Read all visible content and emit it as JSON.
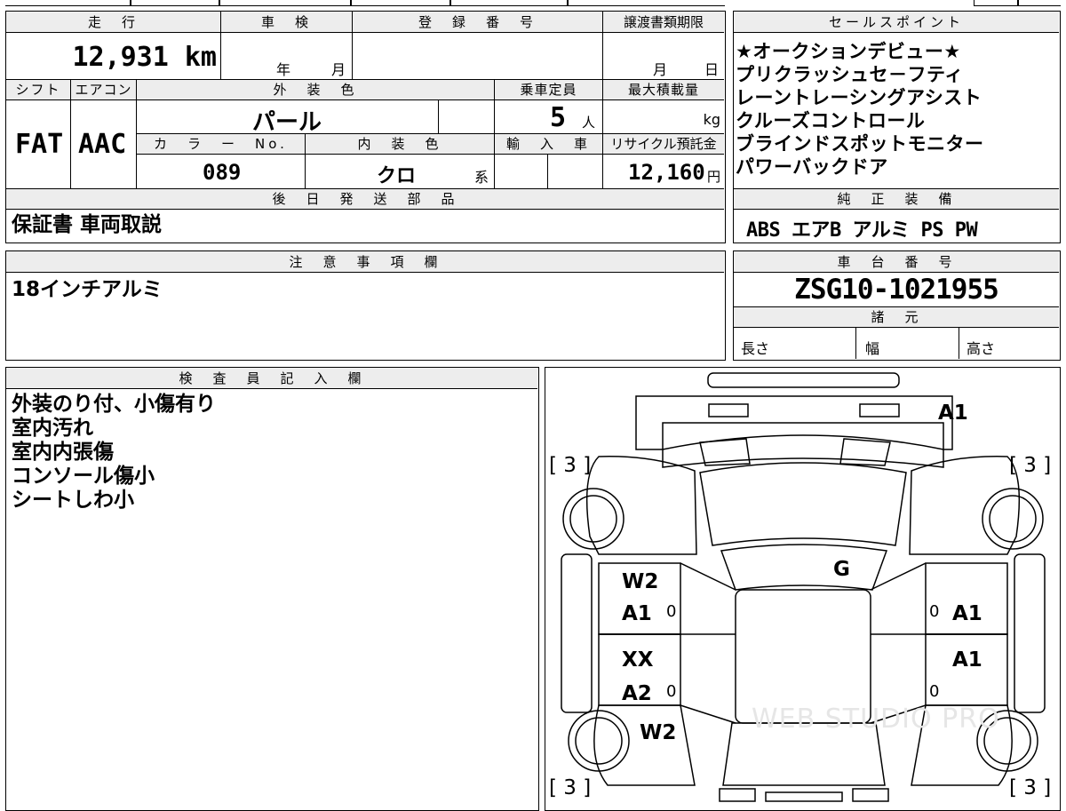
{
  "top_section": {
    "header_mileage": "走　行",
    "header_shaken": "車　検",
    "header_reg_number": "登　録　番　号",
    "header_transfer_deadline": "譲渡書類期限",
    "mileage_value": "12,931 km",
    "shaken_year_label": "年",
    "shaken_month_label": "月",
    "deadline_month_label": "月",
    "deadline_day_label": "日",
    "header_shift": "シフト",
    "header_aircon": "エアコン",
    "header_exterior_color": "外　装　色",
    "header_capacity": "乗車定員",
    "header_max_load": "最大積載量",
    "shift_value": "FAT",
    "aircon_value": "AAC",
    "exterior_color_value": "パール",
    "capacity_value": "5",
    "capacity_unit": "人",
    "max_load_unit": "kg",
    "header_color_no": "カ　ラ　ー　No.",
    "header_interior_color": "内　装　色",
    "header_import": "輸　入　車",
    "header_recycle": "リサイクル預託金",
    "color_no_value": "089",
    "interior_color_value": "クロ",
    "interior_color_suffix": "系",
    "recycle_value": "12,160",
    "recycle_unit": "円",
    "header_later_parts": "後　日　発　送　部　品",
    "later_parts_value": "保証書 車両取説"
  },
  "sales_points": {
    "header": "セールスポイント",
    "items": [
      "★オークションデビュー★",
      "プリクラッシュセ－フティ",
      "レーントレーシングアシスト",
      "クルーズコントロール",
      "ブラインドスポットモニター",
      "パワーバックドア"
    ]
  },
  "standard_equipment": {
    "header": "純　正　装　備",
    "value": "ABS エアB アルミ PS PW"
  },
  "notes": {
    "header": "注　意　事　項　欄",
    "value": "18インチアルミ"
  },
  "chassis": {
    "header": "車　台　番　号",
    "value": "ZSG10-1021955",
    "specs_header": "諸　元",
    "length_label": "長さ",
    "width_label": "幅",
    "height_label": "高さ"
  },
  "inspector": {
    "header": "検　査　員　記　入　欄",
    "lines": [
      "外装のり付、小傷有り",
      "室内汚れ",
      "室内内張傷",
      "コンソール傷小",
      "シートしわ小"
    ]
  },
  "diagram": {
    "tire_fl": "[ 3 ]",
    "tire_fr": "[ 3 ]",
    "tire_rl": "[ 3 ]",
    "tire_rr": "[ 3 ]",
    "front_bumper_mark": "A1",
    "windshield_mark": "G",
    "left_front_door_1": "W2",
    "left_front_door_2": "A1",
    "left_rear_door_1": "XX",
    "left_rear_door_2": "A2",
    "left_rear_fender": "W2",
    "right_front_door": "A1",
    "right_rear_door": "A1",
    "zero_mark": "0",
    "watermark": "WEB STUDIO PRO"
  }
}
